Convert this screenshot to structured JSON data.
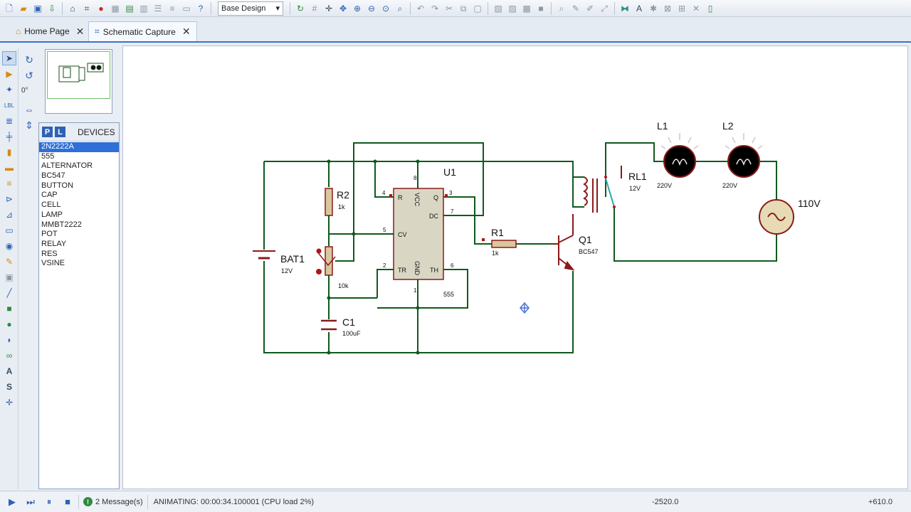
{
  "toolbar": {
    "design_selector": "Base Design",
    "left_icons": [
      "new-file-icon",
      "open-folder-icon",
      "save-icon",
      "import-icon",
      "home-icon",
      "schematic-icon",
      "stop-icon",
      "component-icon",
      "grid-icon",
      "bom-icon",
      "document-icon",
      "report-icon",
      "netlist-icon",
      "help-icon"
    ],
    "right_icons": [
      "refresh-icon",
      "grid-toggle-icon",
      "origin-icon",
      "pan-icon",
      "zoom-in-icon",
      "zoom-out-icon",
      "zoom-all-icon",
      "zoom-area-icon",
      "undo-icon",
      "redo-icon",
      "cut-icon",
      "copy-icon",
      "paste-icon",
      "block-copy-icon",
      "block-move-icon",
      "block-rotate-icon",
      "block-delete-icon",
      "pick-device-icon",
      "make-device-icon",
      "package-icon",
      "decompose-icon",
      "wire-autorouter-icon",
      "search-icon",
      "property-icon",
      "design-explorer-icon",
      "new-sheet-icon",
      "remove-sheet-icon",
      "export-icon"
    ]
  },
  "tabs": [
    {
      "label": "Home Page",
      "icon": "home-icon"
    },
    {
      "label": "Schematic Capture",
      "icon": "schematic-icon"
    }
  ],
  "rotation_angle": "0°",
  "devices_panel": {
    "p_label": "P",
    "l_label": "L",
    "title": "DEVICES",
    "items": [
      "2N2222A",
      "555",
      "ALTERNATOR",
      "BC547",
      "BUTTON",
      "CAP",
      "CELL",
      "LAMP",
      "MMBT2222",
      "POT",
      "RELAY",
      "RES",
      "VSINE"
    ],
    "selected": "2N2222A"
  },
  "schematic": {
    "bat1": {
      "ref": "BAT1",
      "value": "12V"
    },
    "r2": {
      "ref": "R2",
      "value": "1k"
    },
    "pot": {
      "value": "10k"
    },
    "c1": {
      "ref": "C1",
      "value": "100uF"
    },
    "u1": {
      "ref": "U1",
      "part": "555",
      "pins": {
        "r": "R",
        "vcc": "VCC",
        "q": "Q",
        "dc": "DC",
        "cv": "CV",
        "tr": "TR",
        "gnd": "GND",
        "th": "TH"
      },
      "pin_numbers": {
        "p4": "4",
        "p8": "8",
        "p3": "3",
        "p7": "7",
        "p5": "5",
        "p2": "2",
        "p1": "1",
        "p6": "6"
      }
    },
    "r1": {
      "ref": "R1",
      "value": "1k"
    },
    "q1": {
      "ref": "Q1",
      "value": "BC547"
    },
    "rl1": {
      "ref": "RL1",
      "value": "12V"
    },
    "l1": {
      "ref": "L1",
      "value": "220V"
    },
    "l2": {
      "ref": "L2",
      "value": "220V"
    },
    "ac_source": {
      "value": "110V"
    }
  },
  "status": {
    "messages": "2 Message(s)",
    "animating": "ANIMATING: 00:00:34.100001 (CPU load 2%)",
    "coord_x": "-2520.0",
    "coord_y": "+610.0"
  },
  "colors": {
    "wire": "#0f5a1e",
    "component_outline": "#8b1a1a",
    "ic_fill": "#d9d7c4",
    "lamp_on": "#000000",
    "selection": "#2e6fd8"
  }
}
